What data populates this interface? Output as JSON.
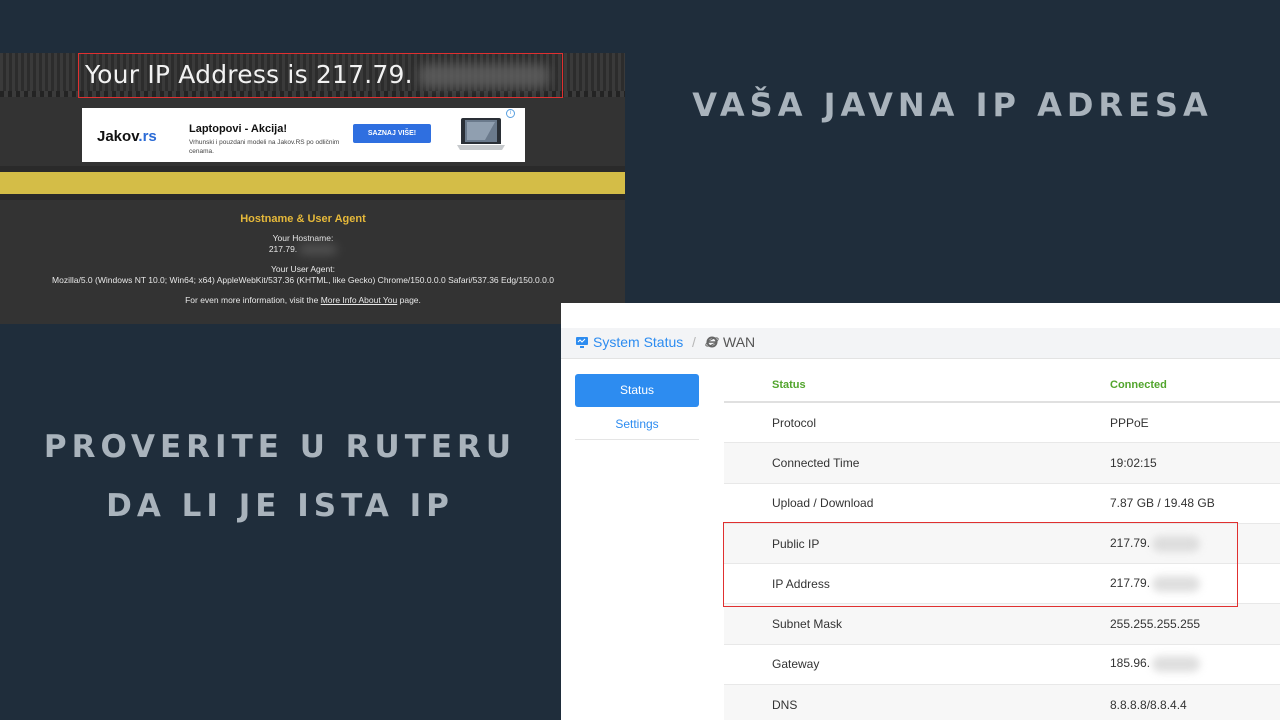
{
  "ip_site": {
    "title": "Your IP Address is 217.79.",
    "ad": {
      "logo_main": "Jakov",
      "logo_suffix": ".rs",
      "headline": "Laptopovi - Akcija!",
      "body": "Vrhunski i pouzdani modeli na Jakov.RS po odličnim cenama.",
      "button": "SAZNAJ VIŠE!",
      "info_icon": "i"
    },
    "section_title": "Hostname & User Agent",
    "hostname_label": "Your Hostname:",
    "hostname_value": "217.79.",
    "ua_label": "Your User Agent:",
    "ua_value": "Mozilla/5.0 (Windows NT 10.0; Win64; x64) AppleWebKit/537.36 (KHTML, like Gecko) Chrome/150.0.0.0 Safari/537.36 Edg/150.0.0.0",
    "more_prefix": "For even more information, visit the ",
    "more_link": "More Info About You",
    "more_suffix": " page."
  },
  "captions": {
    "right": "VAŠA JAVNA IP ADRESA",
    "left_line1": "PROVERITE U RUTERU",
    "left_line2": "DA LI JE ISTA IP"
  },
  "router": {
    "breadcrumb": {
      "system": "System Status",
      "separator": "/",
      "current": "WAN",
      "system_icon": "monitor-icon",
      "current_icon": "ie-icon"
    },
    "sidebar": {
      "active": "Status",
      "link": "Settings"
    },
    "table": {
      "header": {
        "key": "Status",
        "value": "Connected"
      },
      "rows": [
        {
          "key": "Protocol",
          "value": "PPPoE"
        },
        {
          "key": "Connected Time",
          "value": "19:02:15"
        },
        {
          "key": "Upload / Download",
          "value": "7.87 GB / 19.48 GB"
        },
        {
          "key": "Public IP",
          "value": "217.79."
        },
        {
          "key": "IP Address",
          "value": "217.79."
        },
        {
          "key": "Subnet Mask",
          "value": "255.255.255.255"
        },
        {
          "key": "Gateway",
          "value": "185.96."
        },
        {
          "key": "DNS",
          "value": "8.8.8.8/8.8.4.4"
        }
      ]
    }
  },
  "colors": {
    "background": "#1f2d3b",
    "highlight_border": "#e03030",
    "router_accent": "#2d8cf0",
    "status_green": "#52a52d",
    "gold": "#d4bd47"
  }
}
